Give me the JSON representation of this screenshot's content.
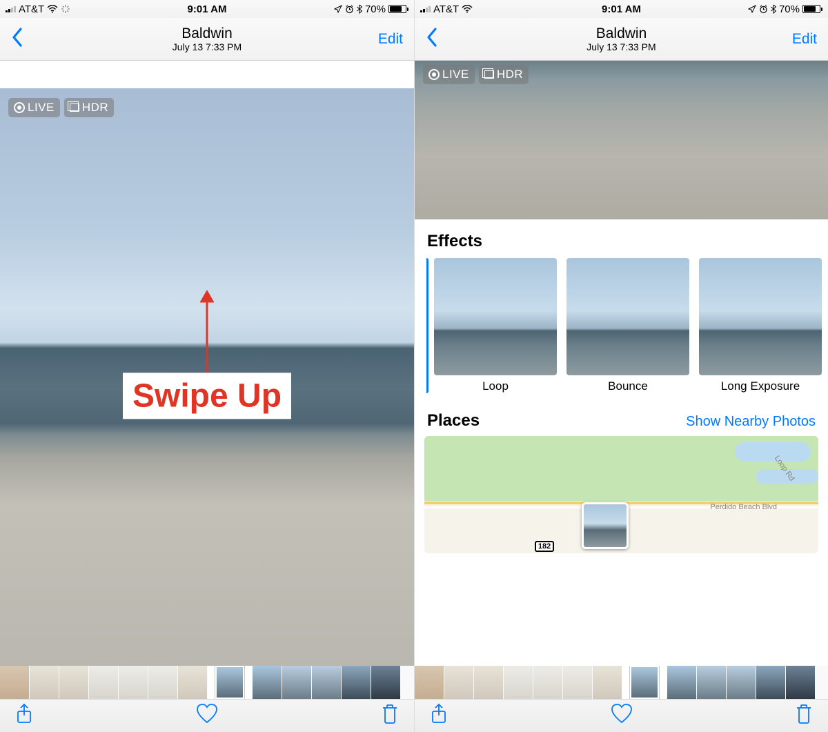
{
  "status": {
    "carrier": "AT&T",
    "time": "9:01 AM",
    "battery_pct": "70%"
  },
  "nav": {
    "title": "Baldwin",
    "subtitle": "July 13  7:33 PM",
    "edit": "Edit"
  },
  "badges": {
    "live": "LIVE",
    "hdr": "HDR"
  },
  "annotation": {
    "swipe": "Swipe Up"
  },
  "details": {
    "effects_heading": "Effects",
    "effects": [
      "Loop",
      "Bounce",
      "Long Exposure"
    ],
    "places_heading": "Places",
    "show_nearby": "Show Nearby Photos",
    "map": {
      "road_label_1": "Loop Rd",
      "road_label_2": "Perdido Beach Blvd",
      "hwy": "182"
    }
  }
}
